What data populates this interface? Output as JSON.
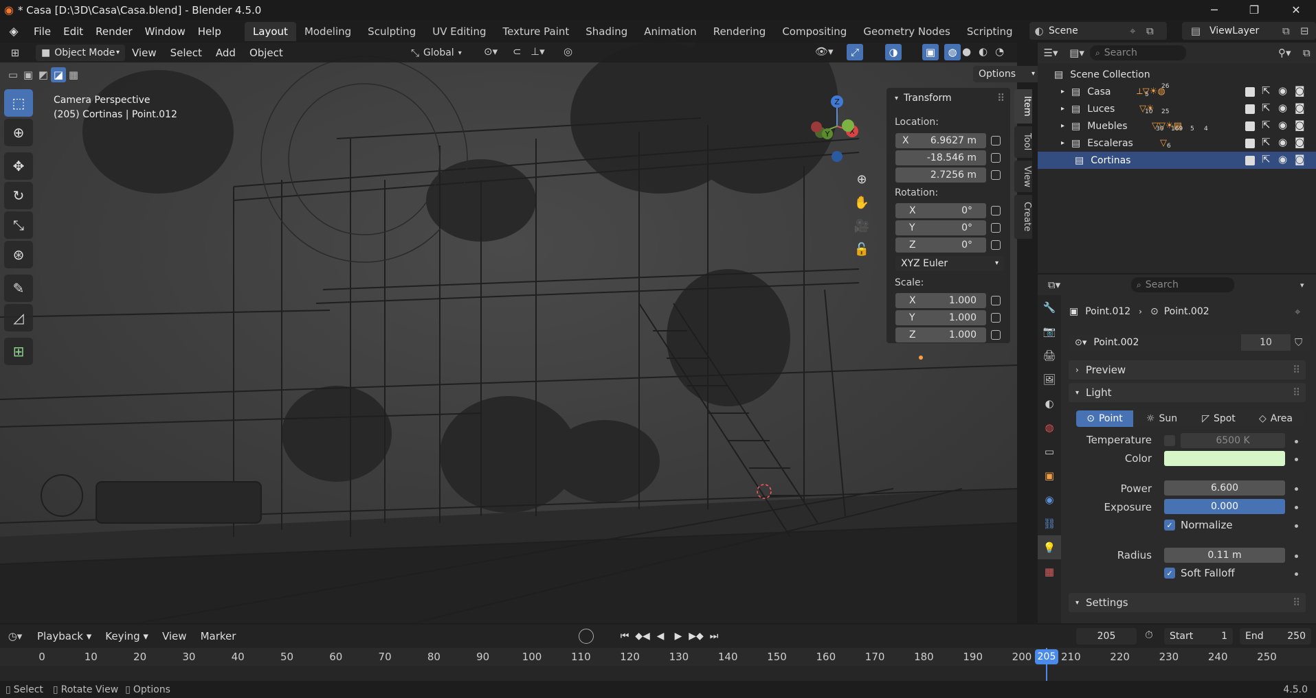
{
  "title_bar": {
    "title": "* Casa [D:\\3D\\Casa\\Casa.blend] - Blender 4.5.0",
    "minimize": "─",
    "maximize": "❐",
    "close": "✕"
  },
  "menus": [
    "File",
    "Edit",
    "Render",
    "Window",
    "Help"
  ],
  "workspaces": [
    "Layout",
    "Modeling",
    "Sculpting",
    "UV Editing",
    "Texture Paint",
    "Shading",
    "Animation",
    "Rendering",
    "Compositing",
    "Geometry Nodes",
    "Scripting",
    "+"
  ],
  "active_workspace": "Layout",
  "scene_selector": {
    "scene": "Scene",
    "view_layer": "ViewLayer"
  },
  "viewport_header": {
    "mode": "Object Mode",
    "menus": [
      "View",
      "Select",
      "Add",
      "Object"
    ],
    "orientation": "Global",
    "options": "Options"
  },
  "viewport_overlay": {
    "line1": "Camera Perspective",
    "line2": "(205) Cortinas | Point.012"
  },
  "npanel": {
    "header": "Transform",
    "location_label": "Location:",
    "location": [
      {
        "axis": "X",
        "value": "6.9627 m"
      },
      {
        "axis": "",
        "value": "-18.546 m"
      },
      {
        "axis": "",
        "value": "2.7256 m"
      }
    ],
    "rotation_label": "Rotation:",
    "rotation": [
      {
        "axis": "X",
        "value": "0°"
      },
      {
        "axis": "Y",
        "value": "0°"
      },
      {
        "axis": "Z",
        "value": "0°"
      }
    ],
    "rotation_mode": "XYZ Euler",
    "scale_label": "Scale:",
    "scale": [
      {
        "axis": "X",
        "value": "1.000"
      },
      {
        "axis": "Y",
        "value": "1.000"
      },
      {
        "axis": "Z",
        "value": "1.000"
      }
    ],
    "tabs": [
      "Item",
      "Tool",
      "View",
      "Create"
    ]
  },
  "gizmo": {
    "z": "Z",
    "y": "Y",
    "x": "X"
  },
  "outliner": {
    "search_placeholder": "Search",
    "root": "Scene Collection",
    "collections": [
      {
        "name": "Casa",
        "badges": [
          "5",
          "26",
          "",
          ""
        ]
      },
      {
        "name": "Luces",
        "badges": [
          "10",
          "25"
        ]
      },
      {
        "name": "Muebles",
        "badges": [
          "30",
          "169",
          "5",
          "4"
        ]
      },
      {
        "name": "Escaleras",
        "badges": [
          "6"
        ]
      },
      {
        "name": "Cortinas",
        "badges": []
      }
    ],
    "selected": "Cortinas"
  },
  "properties": {
    "search_placeholder": "Search",
    "breadcrumb_object": "Point.012",
    "breadcrumb_data": "Point.002",
    "datablock_name": "Point.002",
    "datablock_users": "10",
    "section_preview": "Preview",
    "section_light": "Light",
    "light_types": [
      "Point",
      "Sun",
      "Spot",
      "Area"
    ],
    "active_light_type": "Point",
    "temperature_label": "Temperature",
    "temperature_value": "6500 K",
    "color_label": "Color",
    "color_value": "#d6f6c8",
    "power_label": "Power",
    "power_value": "6.600",
    "exposure_label": "Exposure",
    "exposure_value": "0.000",
    "normalize_label": "Normalize",
    "radius_label": "Radius",
    "radius_value": "0.11 m",
    "soft_falloff_label": "Soft Falloff",
    "section_settings": "Settings"
  },
  "timeline": {
    "menus": [
      "Playback",
      "Keying",
      "View",
      "Marker"
    ],
    "current_frame": "205",
    "start_label": "Start",
    "start": "1",
    "end_label": "End",
    "end": "250",
    "ticks": [
      "0",
      "10",
      "20",
      "30",
      "40",
      "50",
      "60",
      "70",
      "80",
      "90",
      "100",
      "110",
      "120",
      "130",
      "140",
      "150",
      "160",
      "170",
      "180",
      "190",
      "200",
      "210",
      "220",
      "230",
      "240",
      "250"
    ]
  },
  "statusbar": {
    "select": "Select",
    "rotate": "Rotate View",
    "options": "Options",
    "version": "4.5.0"
  }
}
